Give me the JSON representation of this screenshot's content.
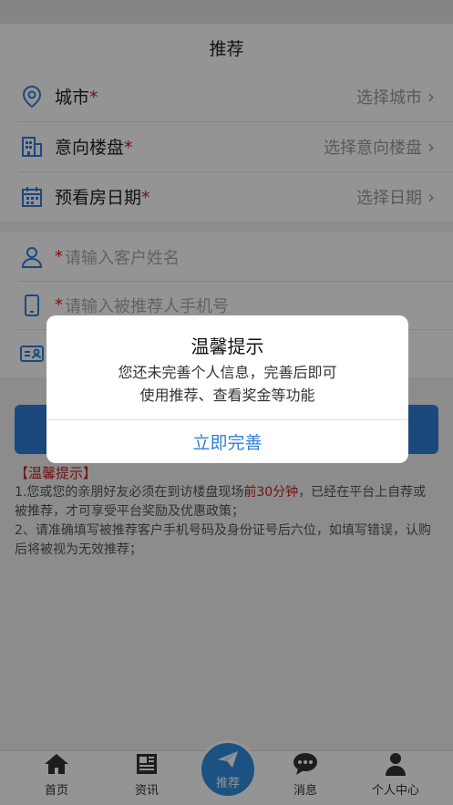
{
  "header": {
    "title": "推荐"
  },
  "selects": [
    {
      "label": "城市",
      "required_mark": "*",
      "value": "选择城市",
      "chevron": "›",
      "icon": "location-pin-icon"
    },
    {
      "label": "意向楼盘",
      "required_mark": "*",
      "value": "选择意向楼盘",
      "chevron": "›",
      "icon": "building-icon"
    },
    {
      "label": "预看房日期",
      "required_mark": "*",
      "value": "选择日期",
      "chevron": "›",
      "icon": "calendar-icon"
    }
  ],
  "inputs": [
    {
      "required_mark": "*",
      "placeholder": "请输入客户姓名",
      "icon": "person-icon"
    },
    {
      "required_mark": "*",
      "placeholder": "请输入被推荐人手机号",
      "icon": "phone-icon"
    },
    {
      "icon": "id-card-icon"
    }
  ],
  "tips": {
    "title": "【温馨提示】",
    "line1_pre": "1.您或您的亲朋好友必须在到访楼盘现场",
    "line1_highlight": "前30分钟",
    "line1_post": "，已经在平台上自荐或被推荐，才可享受平台奖励及优惠政策；",
    "line2": "2、请准确填写被推荐客户手机号码及身份证号后六位，如填写错误，认购后将被视为无效推荐；"
  },
  "tabbar": {
    "items": [
      {
        "label": "首页",
        "icon": "home-icon"
      },
      {
        "label": "资讯",
        "icon": "news-icon"
      },
      {
        "label": "推荐",
        "icon": "paper-plane-icon"
      },
      {
        "label": "消息",
        "icon": "chat-bubble-icon"
      },
      {
        "label": "个人中心",
        "icon": "user-icon"
      }
    ]
  },
  "dialog": {
    "title": "温馨提示",
    "message_line1": "您还未完善个人信息，完善后即可",
    "message_line2": "使用推荐、查看奖金等功能",
    "button": "立即完善"
  },
  "colors": {
    "primary": "#2f7fd8",
    "required": "#c81e1e",
    "overlay": "rgba(0,0,0,0.42)"
  }
}
